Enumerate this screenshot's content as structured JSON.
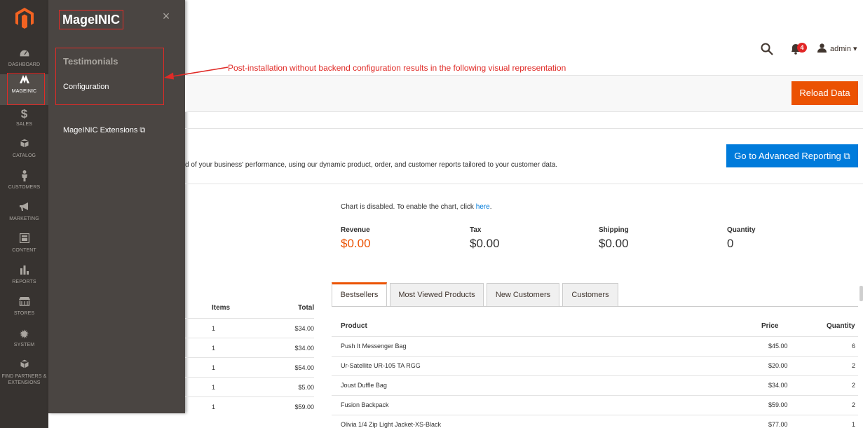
{
  "nav": {
    "items": [
      {
        "label": "DASHBOARD",
        "icon": "dashboard-icon"
      },
      {
        "label": "MAGEINIC",
        "icon": "mageinic-icon"
      },
      {
        "label": "SALES",
        "icon": "dollar-icon"
      },
      {
        "label": "CATALOG",
        "icon": "catalog-icon"
      },
      {
        "label": "CUSTOMERS",
        "icon": "customers-icon"
      },
      {
        "label": "MARKETING",
        "icon": "megaphone-icon"
      },
      {
        "label": "CONTENT",
        "icon": "content-icon"
      },
      {
        "label": "REPORTS",
        "icon": "bar-chart-icon"
      },
      {
        "label": "STORES",
        "icon": "store-icon"
      },
      {
        "label": "SYSTEM",
        "icon": "gear-icon"
      },
      {
        "label": "FIND PARTNERS & EXTENSIONS",
        "icon": "partners-icon"
      }
    ]
  },
  "submenu": {
    "title": "MageINIC",
    "close": "×",
    "group_title": "Testimonials",
    "configuration": "Configuration",
    "extensions": "MageINIC Extensions ⧉"
  },
  "annotation": "Post-installation without backend configuration results in the following visual representation",
  "header": {
    "notifications_count": "4",
    "user": "admin ▾"
  },
  "toolbar": {
    "reload": "Reload Data"
  },
  "advanced": {
    "text": "d of your business' performance, using our dynamic product, order, and customer reports tailored to your customer data.",
    "button": "Go to Advanced Reporting ⧉"
  },
  "chart": {
    "disabled_text": "Chart is disabled. To enable the chart, click ",
    "link": "here",
    "link_suffix": "."
  },
  "totals": [
    {
      "label": "Revenue",
      "value": "$0.00"
    },
    {
      "label": "Tax",
      "value": "$0.00"
    },
    {
      "label": "Shipping",
      "value": "$0.00"
    },
    {
      "label": "Quantity",
      "value": "0"
    }
  ],
  "left_grid": {
    "headers": {
      "items": "Items",
      "total": "Total"
    },
    "rows": [
      {
        "items": "1",
        "total": "$34.00"
      },
      {
        "items": "1",
        "total": "$34.00"
      },
      {
        "items": "1",
        "total": "$54.00"
      },
      {
        "items": "1",
        "total": "$5.00"
      },
      {
        "items": "1",
        "total": "$59.00"
      }
    ]
  },
  "tabs": [
    "Bestsellers",
    "Most Viewed Products",
    "New Customers",
    "Customers"
  ],
  "bestsellers": {
    "headers": {
      "product": "Product",
      "price": "Price",
      "quantity": "Quantity"
    },
    "rows": [
      {
        "product": "Push It Messenger Bag",
        "price": "$45.00",
        "quantity": "6"
      },
      {
        "product": "Ur-Satellite UR-105 TA RGG",
        "price": "$20.00",
        "quantity": "2"
      },
      {
        "product": "Joust Duffle Bag",
        "price": "$34.00",
        "quantity": "2"
      },
      {
        "product": "Fusion Backpack",
        "price": "$59.00",
        "quantity": "2"
      },
      {
        "product": "Olivia 1/4 Zip Light Jacket-XS-Black",
        "price": "$77.00",
        "quantity": "1"
      }
    ]
  },
  "colors": {
    "nav_bg": "#373330",
    "submenu_bg": "#4a4542",
    "accent_orange": "#eb5202",
    "accent_blue": "#007bdb",
    "annotation_red": "#e02b27"
  }
}
